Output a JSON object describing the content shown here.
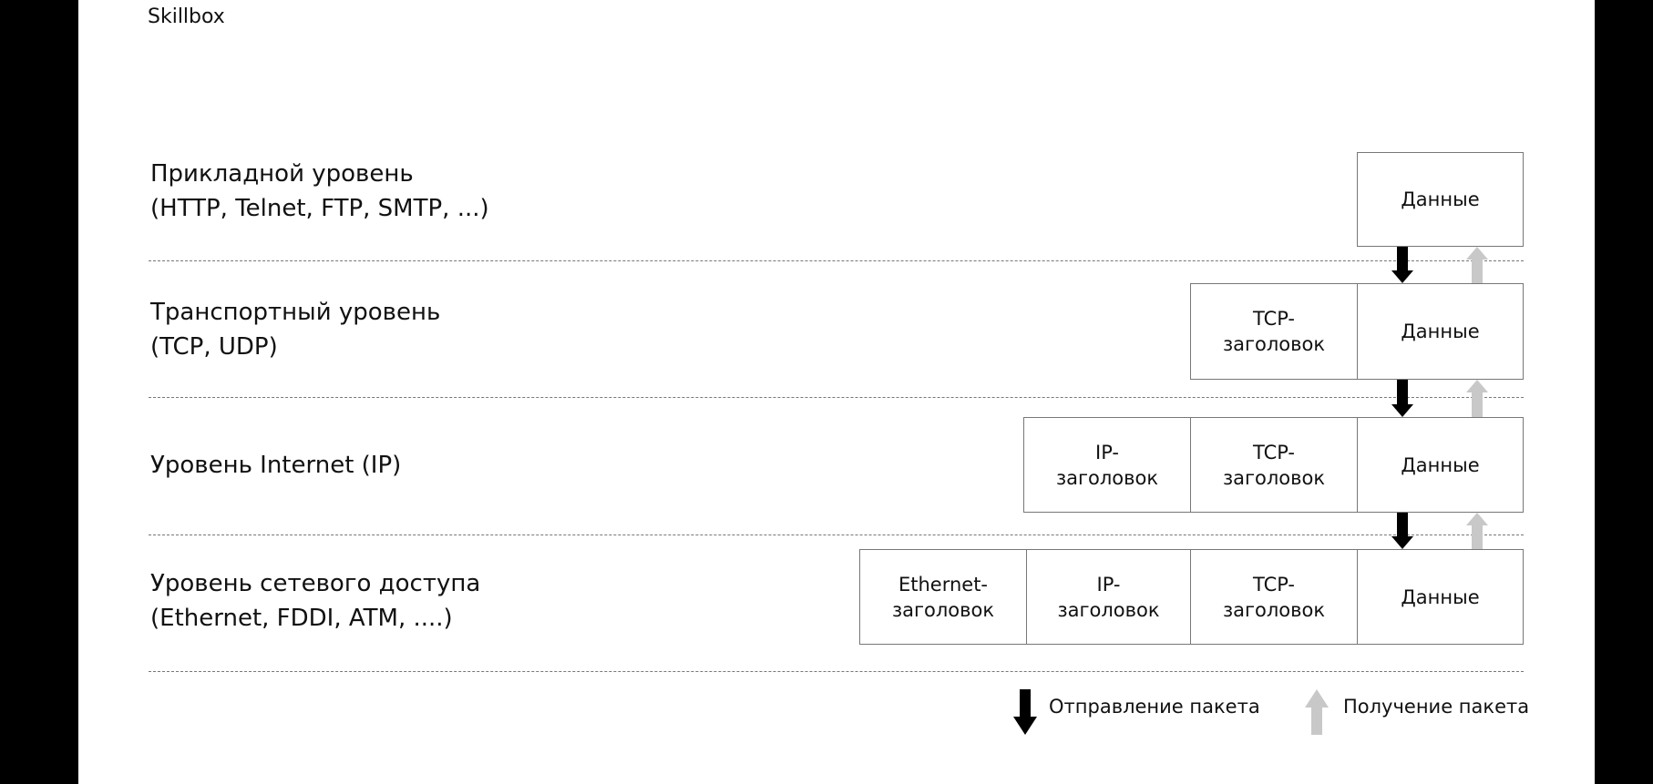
{
  "brand": "Skillbox",
  "layers": [
    {
      "name": "Прикладной уровень",
      "protocols": "(HTTP, Telnet, FTP, SMTP, ...)",
      "cells": [
        "Данные"
      ]
    },
    {
      "name": "Транспортный уровень",
      "protocols": "(TCP, UDP)",
      "cells": [
        "TCP-\nзаголовок",
        "Данные"
      ]
    },
    {
      "name": "Уровень Internet (IP)",
      "protocols": "",
      "cells": [
        "IP-\nзаголовок",
        "TCP-\nзаголовок",
        "Данные"
      ]
    },
    {
      "name": "Уровень сетевого доступа",
      "protocols": "(Ethernet, FDDI, ATM, ....)",
      "cells": [
        "Ethernet-\nзаголовок",
        "IP-\nзаголовок",
        "TCP-\nзаголовок",
        "Данные"
      ]
    }
  ],
  "legend": {
    "send": "Отправление пакета",
    "receive": "Получение пакета"
  },
  "colors": {
    "send_arrow": "#000000",
    "receive_arrow": "#c8c8c8"
  }
}
